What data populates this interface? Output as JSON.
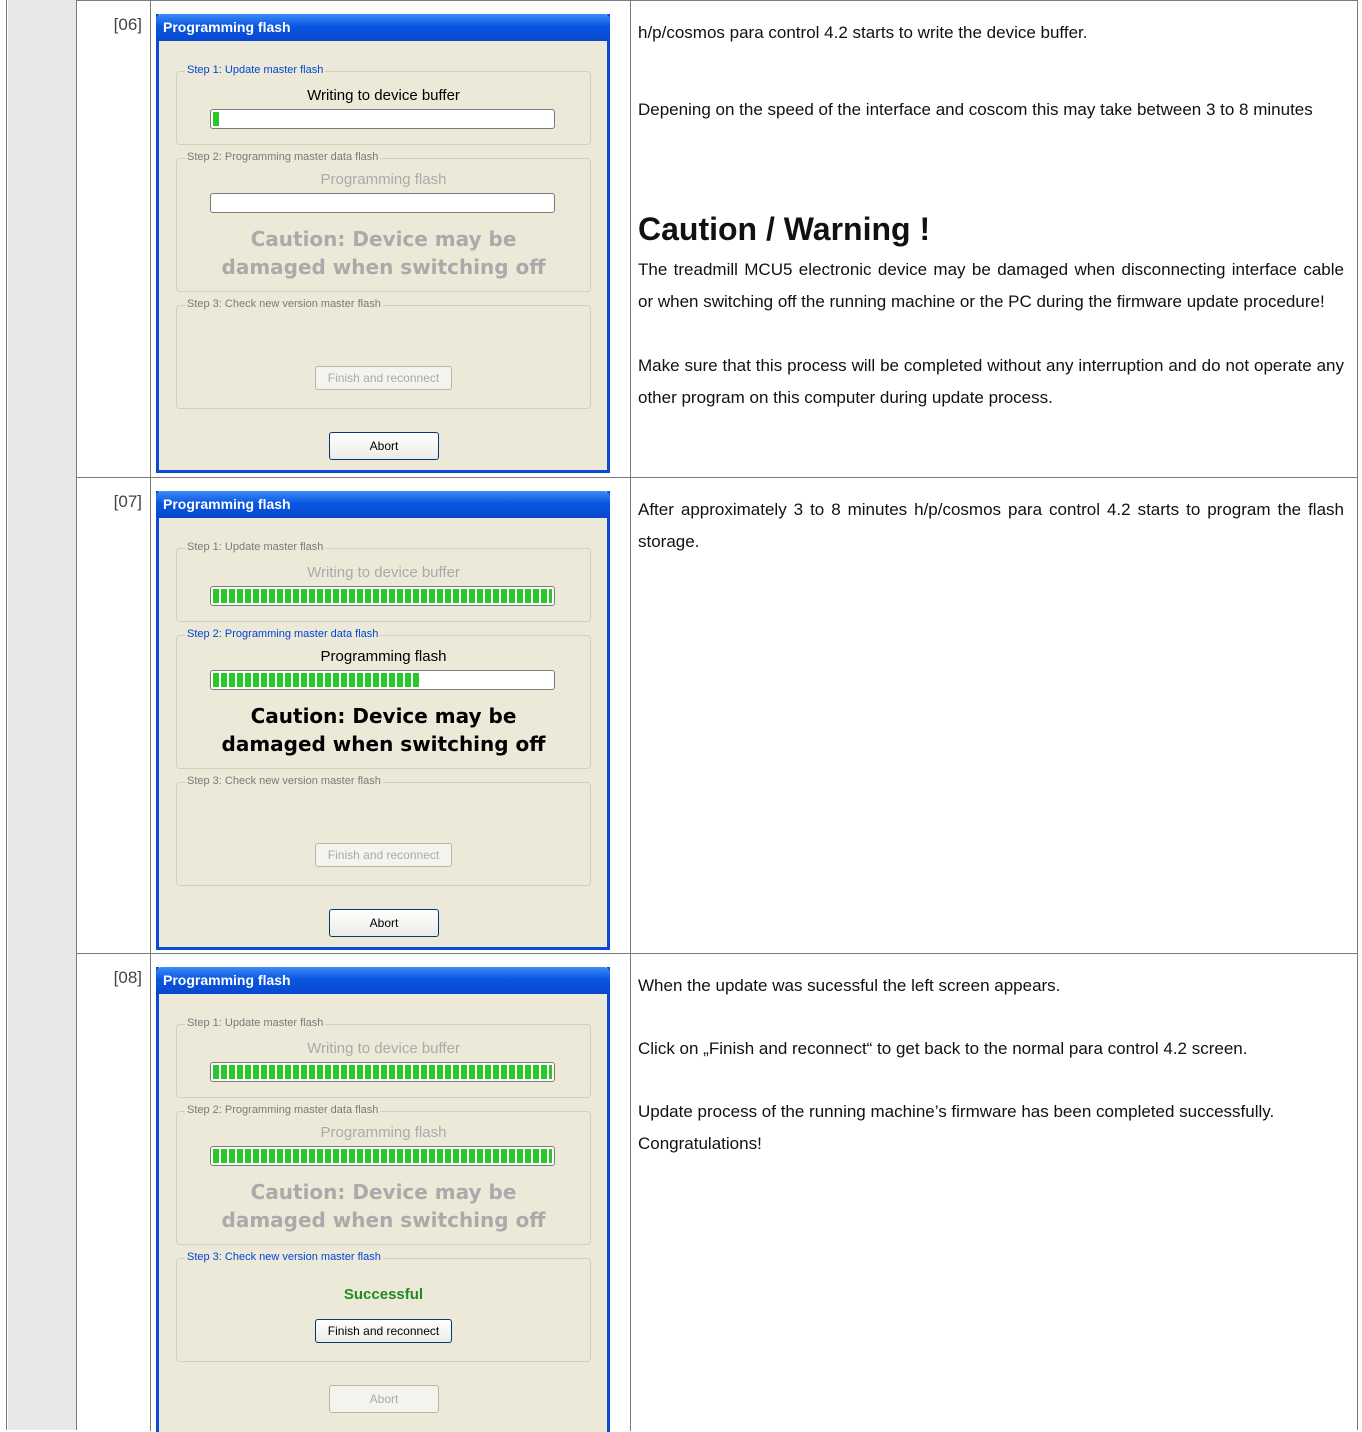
{
  "rows": [
    {
      "num": "[06]",
      "window": {
        "title": "Programming flash",
        "step1_label": "Step 1: Update  master flash",
        "step1_text": "Writing to device buffer",
        "step1_progress": 0.02,
        "step2_label": "Step 2: Programming master data flash",
        "step2_text": "Programming flash",
        "step2_progress": 0,
        "caution": "Caution: Device may be damaged when switching off",
        "step3_label": "Step 3: Check new version master flash",
        "step3_status": "",
        "finish_label": "Finish and reconnect",
        "abort_label": "Abort"
      },
      "desc": {
        "p1": "h/p/cosmos para control 4.2 starts to write the device buffer.",
        "p2": "Depening on the speed of the interface and coscom this may take between 3 to 8 minutes",
        "heading": "Caution / Warning !",
        "p3": "The treadmill MCU5 electronic device may be damaged when disconnecting interface cable or when switching off the running machine or the PC during the firmware update procedure!",
        "p4": "Make sure that this process will be completed without any interruption and do not operate any other program on this computer during update process."
      }
    },
    {
      "num": "[07]",
      "window": {
        "title": "Programming flash",
        "step1_label": "Step 1: Update  master flash",
        "step1_text": "Writing to device buffer",
        "step1_progress": 1,
        "step2_label": "Step 2: Programming master data flash",
        "step2_text": "Programming flash",
        "step2_progress": 0.61,
        "caution": "Caution: Device may be damaged when switching off",
        "step3_label": "Step 3: Check new version master flash",
        "step3_status": "",
        "finish_label": "Finish and reconnect",
        "abort_label": "Abort"
      },
      "desc": {
        "p1": "After approximately 3 to 8 minutes h/p/cosmos para control 4.2 starts to program the flash storage."
      }
    },
    {
      "num": "[08]",
      "window": {
        "title": "Programming flash",
        "step1_label": "Step 1: Update  master flash",
        "step1_text": "Writing to device buffer",
        "step1_progress": 1,
        "step2_label": "Step 2: Programming master data flash",
        "step2_text": "Programming flash",
        "step2_progress": 1,
        "caution": "Caution: Device may be damaged when switching off",
        "step3_label": "Step 3: Check new version master flash",
        "step3_status": "Successful",
        "finish_label": "Finish and reconnect",
        "abort_label": "Abort"
      },
      "desc": {
        "p1": "When the update was sucessful the left screen appears.",
        "p2": "Click on „Finish and reconnect“ to get back to the normal para control 4.2 screen.",
        "p3": "Update process of the running machine’s firmware has been completed successfully. Congratulations!"
      }
    }
  ]
}
